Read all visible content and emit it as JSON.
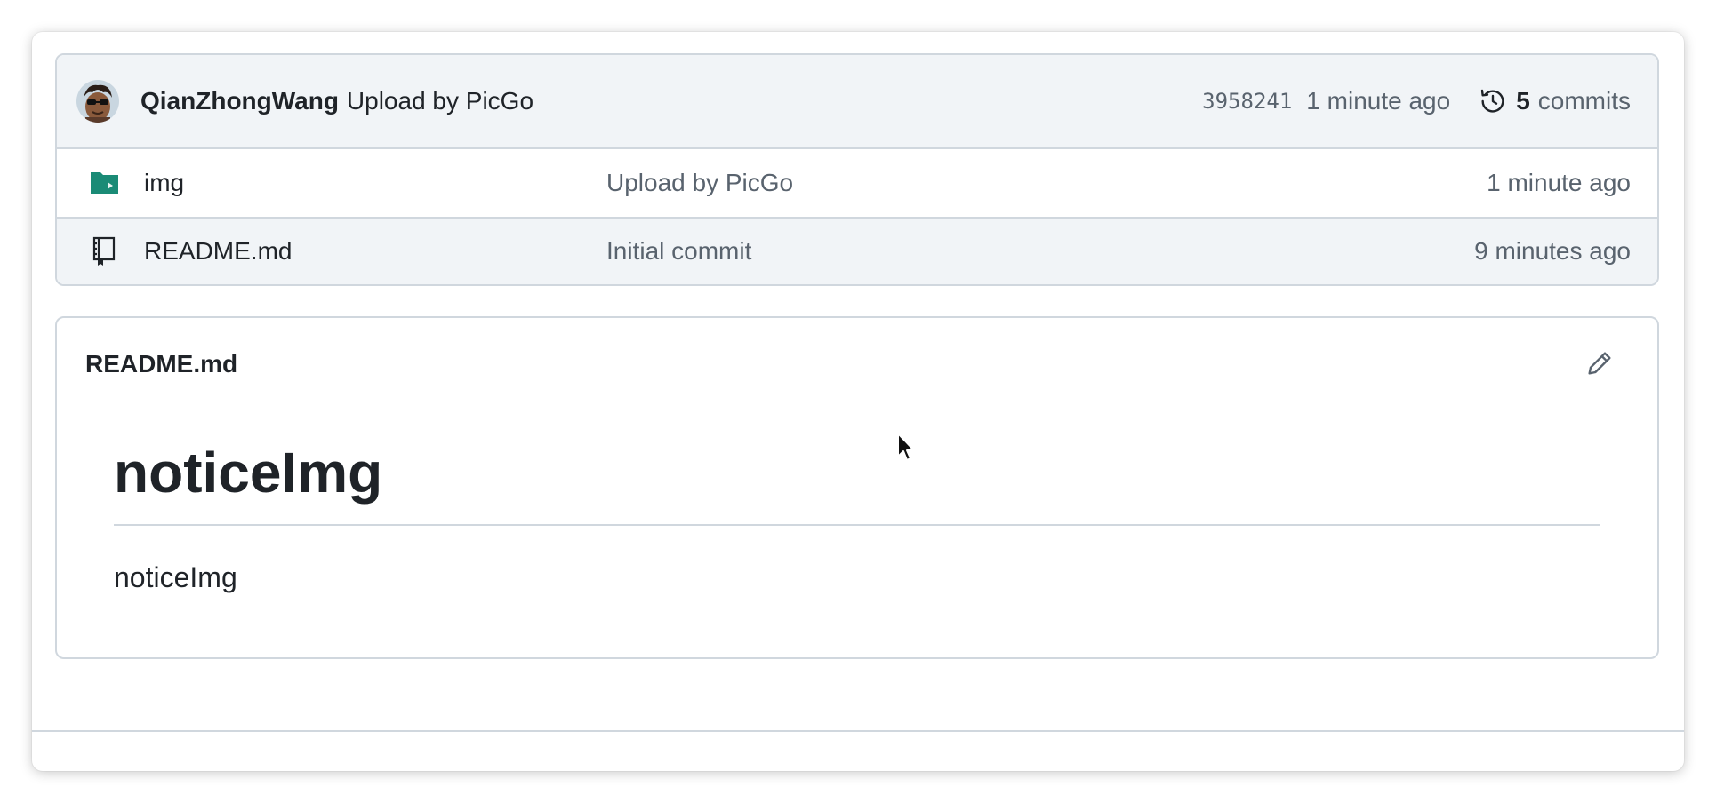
{
  "latest_commit": {
    "author": "QianZhongWang",
    "message": "Upload by PicGo",
    "sha": "3958241",
    "time": "1 minute ago",
    "commit_count": "5",
    "commits_label": "commits"
  },
  "files": [
    {
      "name": "img",
      "type": "folder",
      "message": "Upload by PicGo",
      "time": "1 minute ago"
    },
    {
      "name": "README.md",
      "type": "file",
      "message": "Initial commit",
      "time": "9 minutes ago"
    }
  ],
  "readme": {
    "title": "README.md",
    "heading": "noticeImg",
    "paragraph": "noticeImg"
  },
  "colors": {
    "folder_icon": "#1a8b76",
    "header_bg": "#f1f4f7",
    "border": "#d0d7de",
    "muted_text": "#59636e"
  }
}
